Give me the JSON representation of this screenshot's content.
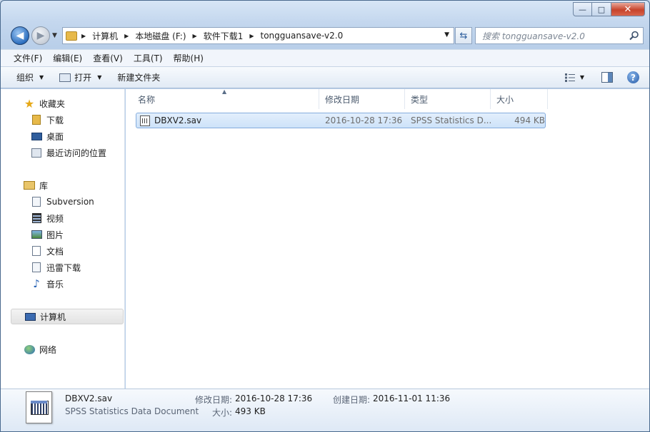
{
  "window": {
    "minimize": "—",
    "maximize": "□",
    "close": "✕"
  },
  "address": {
    "crumbs": [
      "计算机",
      "本地磁盘 (F:)",
      "软件下载1",
      "tongguansave-v2.0"
    ]
  },
  "search": {
    "placeholder": "搜索 tongguansave-v2.0"
  },
  "menubar": [
    "文件(F)",
    "编辑(E)",
    "查看(V)",
    "工具(T)",
    "帮助(H)"
  ],
  "toolbar": {
    "organize": "组织",
    "open": "打开",
    "new_folder": "新建文件夹"
  },
  "sidebar": {
    "favorites": {
      "label": "收藏夹",
      "items": [
        "下载",
        "桌面",
        "最近访问的位置"
      ]
    },
    "libraries": {
      "label": "库",
      "items": [
        "Subversion",
        "视频",
        "图片",
        "文档",
        "迅雷下载",
        "音乐"
      ]
    },
    "computer": "计算机",
    "network": "网络"
  },
  "columns": [
    "名称",
    "修改日期",
    "类型",
    "大小"
  ],
  "files": [
    {
      "name": "DBXV2.sav",
      "modified": "2016-10-28 17:36",
      "type": "SPSS Statistics D...",
      "size": "494 KB"
    }
  ],
  "details": {
    "name": "DBXV2.sav",
    "type": "SPSS Statistics Data Document",
    "modified_label": "修改日期:",
    "modified": "2016-10-28 17:36",
    "created_label": "创建日期:",
    "created": "2016-11-01 11:36",
    "size_label": "大小:",
    "size": "493 KB"
  },
  "icons": {
    "back": "back-arrow-icon",
    "forward": "forward-arrow-icon",
    "refresh": "refresh-icon",
    "search": "search-icon",
    "help": "help-icon",
    "file": "spss-file-icon"
  }
}
